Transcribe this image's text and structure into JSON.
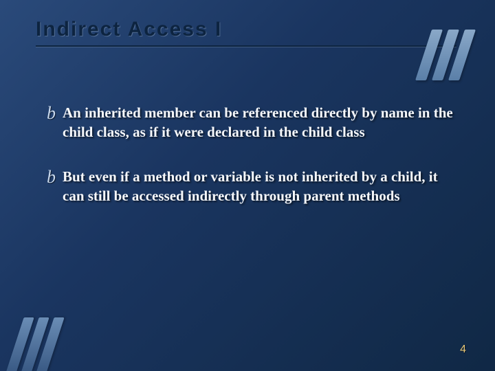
{
  "slide": {
    "title": "Indirect Access I",
    "bullets": [
      {
        "icon": "b",
        "text": "An inherited member can be referenced directly by name in the child class, as if it were declared in the child class"
      },
      {
        "icon": "b",
        "text": "But even if a method or variable is not inherited by a child, it can still be accessed indirectly through parent methods"
      }
    ],
    "page_number": "4"
  }
}
